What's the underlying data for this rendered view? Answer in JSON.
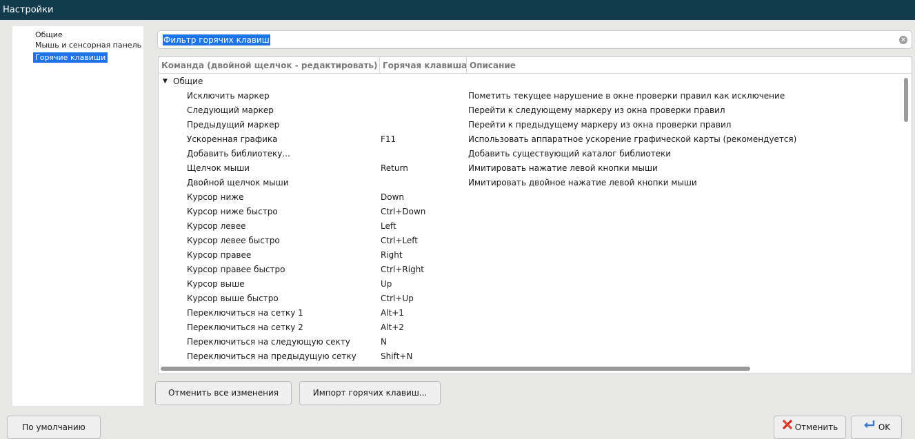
{
  "window": {
    "title": "Настройки"
  },
  "sidebar": {
    "items": [
      {
        "label": "Общие"
      },
      {
        "label": "Мышь и сенсорная панель"
      },
      {
        "label": "Горячие клавиши"
      }
    ],
    "selected": "Горячие клавиши"
  },
  "search": {
    "value": "Фильтр горячих клавиш"
  },
  "table": {
    "columns": [
      {
        "label": "Команда (двойной щелчок - редактировать)"
      },
      {
        "label": "Горячая клавиша"
      },
      {
        "label": "Описание"
      }
    ],
    "group": {
      "label": "Общие",
      "expanded": true
    },
    "rows": [
      {
        "command": "Исключить маркер",
        "hotkey": "",
        "description": "Пометить текущее нарушение в окне проверки правил как исключение"
      },
      {
        "command": "Следующий маркер",
        "hotkey": "",
        "description": "Перейти к следующему маркеру из окна проверки правил"
      },
      {
        "command": "Предыдущий маркер",
        "hotkey": "",
        "description": "Перейти к предыдущему маркеру из окна проверки правил"
      },
      {
        "command": "Ускоренная графика",
        "hotkey": "F11",
        "description": "Использовать аппаратное ускорение графической карты (рекомендуется)"
      },
      {
        "command": "Добавить библиотеку...",
        "hotkey": "",
        "description": "Добавить существующий каталог библиотеки"
      },
      {
        "command": "Щелчок мыши",
        "hotkey": "Return",
        "description": "Имитировать нажатие левой кнопки мыши"
      },
      {
        "command": "Двойной щелчок мыши",
        "hotkey": "",
        "description": "Имитировать двойное нажатие левой кнопки мыши"
      },
      {
        "command": "Курсор ниже",
        "hotkey": "Down",
        "description": ""
      },
      {
        "command": "Курсор ниже быстро",
        "hotkey": "Ctrl+Down",
        "description": ""
      },
      {
        "command": "Курсор левее",
        "hotkey": "Left",
        "description": ""
      },
      {
        "command": "Курсор левее быстро",
        "hotkey": "Ctrl+Left",
        "description": ""
      },
      {
        "command": "Курсор правее",
        "hotkey": "Right",
        "description": ""
      },
      {
        "command": "Курсор правее быстро",
        "hotkey": "Ctrl+Right",
        "description": ""
      },
      {
        "command": "Курсор выше",
        "hotkey": "Up",
        "description": ""
      },
      {
        "command": "Курсор выше быстро",
        "hotkey": "Ctrl+Up",
        "description": ""
      },
      {
        "command": "Переключиться на сетку 1",
        "hotkey": "Alt+1",
        "description": ""
      },
      {
        "command": "Переключиться на сетку 2",
        "hotkey": "Alt+2",
        "description": ""
      },
      {
        "command": "Переключиться на следующую секту",
        "hotkey": "N",
        "description": ""
      },
      {
        "command": "Переключиться на предыдущую сетку",
        "hotkey": "Shift+N",
        "description": ""
      }
    ]
  },
  "buttons": {
    "undo_all": "Отменить все изменения",
    "import": "Импорт горячих клавиш...",
    "defaults": "По умолчанию",
    "cancel": "Отменить",
    "ok": "OK"
  },
  "icons": {
    "cancel": "red-x-icon",
    "ok": "enter-arrow-icon",
    "clear": "clear-icon",
    "expand": "triangle-down-icon"
  },
  "colors": {
    "titlebar": "#123c4c",
    "selection": "#1e73e8",
    "cancel_icon": "#d62a1e",
    "ok_icon": "#3a78c8"
  }
}
